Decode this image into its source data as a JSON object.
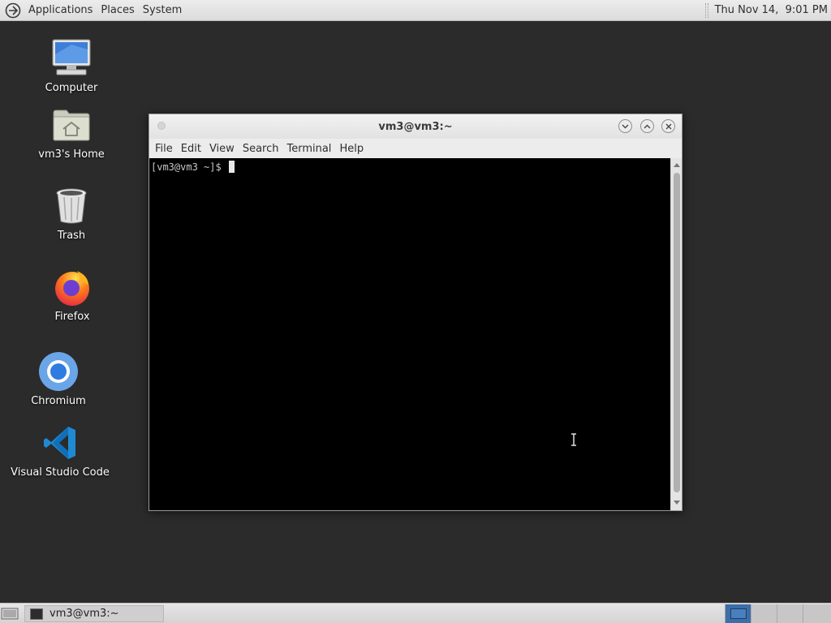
{
  "top_panel": {
    "menus": [
      "Applications",
      "Places",
      "System"
    ],
    "clock": "Thu Nov 14,  9:01 PM"
  },
  "desktop_icons": [
    {
      "label": "Computer",
      "icon": "computer-icon"
    },
    {
      "label": "vm3's Home",
      "icon": "home-folder-icon"
    },
    {
      "label": "Trash",
      "icon": "trash-icon"
    },
    {
      "label": "Firefox",
      "icon": "firefox-icon"
    },
    {
      "label": "Chromium",
      "icon": "chromium-icon"
    },
    {
      "label": "Visual Studio Code",
      "icon": "vscode-icon"
    }
  ],
  "terminal": {
    "title": "vm3@vm3:~",
    "menus": [
      "File",
      "Edit",
      "View",
      "Search",
      "Terminal",
      "Help"
    ],
    "prompt": "[vm3@vm3 ~]$ "
  },
  "taskbar": {
    "task_label": "vm3@vm3:~",
    "workspaces": 4,
    "active_workspace": 1
  },
  "colors": {
    "desktop": "#2b2b2b",
    "terminal_bg": "#000000",
    "active_workspace": "#3c6ea8"
  }
}
